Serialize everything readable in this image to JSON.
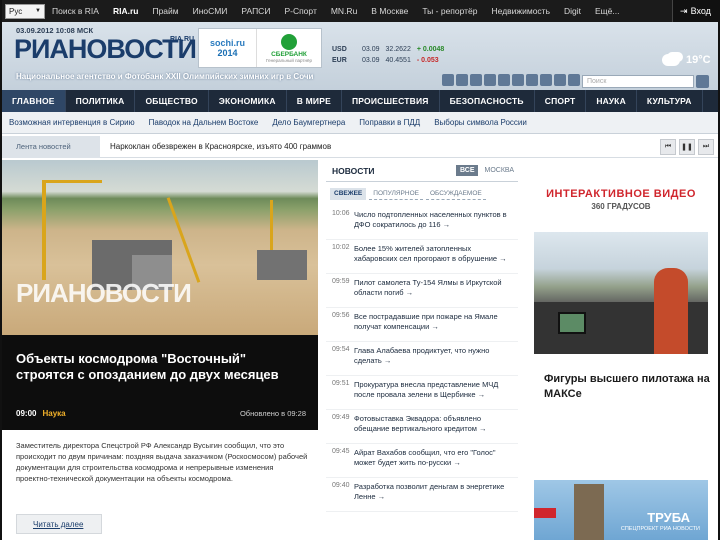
{
  "topbar": {
    "lang": "Рус",
    "links": [
      "Поиск в RIA",
      "RIA.ru",
      "Прайм",
      "ИноСМИ",
      "РАПСИ",
      "Р-Спорт",
      "MN.Ru",
      "В Москве",
      "Ты - репортёр",
      "Недвижимость",
      "Digit",
      "Ещё..."
    ],
    "login": "Вход",
    "login_icon": "login-icon"
  },
  "header": {
    "date": "03.09.2012 10:08 МСК",
    "logo": "РИАНОВОСТИ",
    "logo_suffix": "RIA.RU",
    "tagline": "Национальное агентство и Фотобанк ХХII Олимпийских зимних игр в Сочи",
    "sochi_line1": "sochi.ru",
    "sochi_line2": "2014",
    "sber_name": "СБЕРБАНК",
    "sber_sub": "Генеральный партнёр",
    "rates": [
      {
        "label": "USD",
        "date": "03.09",
        "value": "32.2622",
        "change": "+ 0.0048",
        "dir": "up"
      },
      {
        "label": "EUR",
        "date": "03.09",
        "value": "40.4551",
        "change": "- 0.053",
        "dir": "down"
      }
    ],
    "search_placeholder": "Поиск",
    "weather_temp": "19°C",
    "weather_icon": "cloud-icon"
  },
  "mainnav": [
    "ГЛАВНОЕ",
    "ПОЛИТИКА",
    "ОБЩЕСТВО",
    "ЭКОНОМИКА",
    "В МИРЕ",
    "ПРОИСШЕСТВИЯ",
    "БЕЗОПАСНОСТЬ",
    "СПОРТ",
    "НАУКА",
    "КУЛЬТУРА"
  ],
  "subnav": [
    "Возможная интервенция в Сирию",
    "Паводок на Дальнем Востоке",
    "Дело Баумгертнера",
    "Поправки в ПДД",
    "Выборы символа России"
  ],
  "ticker": {
    "label": "Лента новостей",
    "text": "Наркоклан обезврежен в Красноярске, изъято 400 граммов"
  },
  "hero": {
    "watermark": "РИАНОВОСТИ",
    "title": "Объекты космодрома \"Восточный\" строятся с опозданием до двух месяцев",
    "time": "09:00",
    "category": "Наука",
    "updated": "Обновлено в 09:28",
    "lead": "Заместитель директора Спецстрой РФ Александр Вусыгин сообщил, что это происходит по двум причинам: поздняя выдача заказчиком (Роскосмосом) рабочей документации для строительства космодрома и непрерывные изменения проектно-технической документации на объекты космодрома.",
    "read_more": "Читать далее"
  },
  "news": {
    "title": "НОВОСТИ",
    "tabs": [
      "ВСЕ",
      "МОСКВА"
    ],
    "filters": [
      "СВЕЖЕЕ",
      "ПОПУЛЯРНОЕ",
      "ОБСУЖДАЕМОЕ"
    ],
    "items": [
      {
        "time": "10:06",
        "text": "Число подтопленных населенных пунктов в ДФО сократилось до 116 →"
      },
      {
        "time": "10:02",
        "text": "Более 15% жителей затопленных хабаровских сел прогорают в обрушение →"
      },
      {
        "time": "09:59",
        "text": "Пилот самолета Ту-154 Ялмы в Иркутской области погиб →"
      },
      {
        "time": "09:56",
        "text": "Все пострадавшие при пожаре на Ямале получат компенсации →"
      },
      {
        "time": "09:54",
        "text": "Глава Алабаева продиктует, что нужно сделать →"
      },
      {
        "time": "09:51",
        "text": "Прокуратура внесла представление МЧД после провала зелени в Щербинке →"
      },
      {
        "time": "09:49",
        "text": "Фотовыставка Эквадора: объявлено обещание вертикального кредитом →"
      },
      {
        "time": "09:45",
        "text": "Айрат Вахабов сообщил, что его \"Голос\" может будет жить по-русски →"
      },
      {
        "time": "09:40",
        "text": "Разработка позволит деньгам в энергетике Ленне →"
      }
    ]
  },
  "right": {
    "video_title": "ИНТЕРАКТИВНОЕ ВИДЕО",
    "video_sub": "360 ГРАДУСОВ",
    "video_caption": "Фигуры высшего пилотажа на МАКСе",
    "promo_title": "ТРУБА",
    "promo_sub": "СПЕЦПРОЕКТ РИА НОВОСТИ"
  },
  "colors": {
    "nav_bg": "#1e2a3a",
    "accent_red": "#d0262d",
    "brand_blue": "#1b3d6b",
    "category": "#f0b02a"
  }
}
